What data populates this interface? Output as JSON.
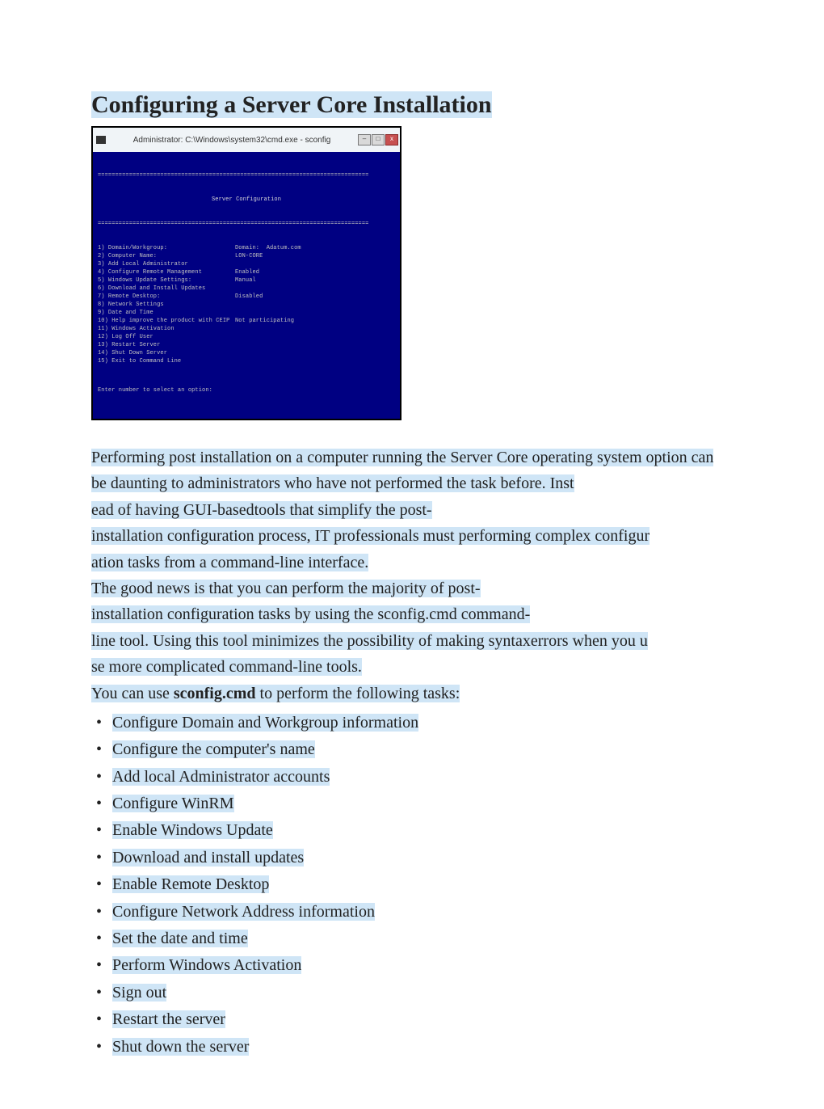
{
  "title": "Configuring a Server Core Installation",
  "screenshot": {
    "titlebar": "Administrator: C:\\Windows\\system32\\cmd.exe - sconfig",
    "divider": "==============================================================================",
    "header": "Server Configuration",
    "rows": [
      {
        "l": "1) Domain/Workgroup:",
        "r": "Domain:  Adatum.com"
      },
      {
        "l": "2) Computer Name:",
        "r": "LON-CORE"
      },
      {
        "l": "3) Add Local Administrator",
        "r": ""
      },
      {
        "l": "4) Configure Remote Management",
        "r": "Enabled"
      },
      {
        "l": "",
        "r": ""
      },
      {
        "l": "5) Windows Update Settings:",
        "r": "Manual"
      },
      {
        "l": "6) Download and Install Updates",
        "r": ""
      },
      {
        "l": "7) Remote Desktop:",
        "r": "Disabled"
      },
      {
        "l": "",
        "r": ""
      },
      {
        "l": "8) Network Settings",
        "r": ""
      },
      {
        "l": "9) Date and Time",
        "r": ""
      },
      {
        "l": "10) Help improve the product with CEIP",
        "r": "Not participating"
      },
      {
        "l": "11) Windows Activation",
        "r": ""
      },
      {
        "l": "",
        "r": ""
      },
      {
        "l": "12) Log Off User",
        "r": ""
      },
      {
        "l": "13) Restart Server",
        "r": ""
      },
      {
        "l": "14) Shut Down Server",
        "r": ""
      },
      {
        "l": "15) Exit to Command Line",
        "r": ""
      }
    ],
    "prompt": "Enter number to select an option:"
  },
  "para1_a": "Performing post installation on a computer running the Server Core operating system option can be daunting to administrators who have not performed the task before. Inst",
  "para1_b": "ead of having GUI-basedtools that simplify the post-",
  "para1_c": "installation configuration process, IT professionals must performing complex configur",
  "para1_d": "ation tasks from a command-line interface.",
  "para2_a": "The good news is that you can perform the majority of post-",
  "para2_b": "installation configuration tasks by using the sconfig.cmd command-",
  "para2_c": "line tool. Using this tool minimizes the possibility of making syntaxerrors when you u",
  "para2_d": "se more complicated command-line tools.",
  "tasks_intro_a": "You can use ",
  "tasks_intro_b": "sconfig.cmd",
  "tasks_intro_c": " to perform the following tasks:",
  "tasks": [
    "Configure Domain and Workgroup information",
    "Configure the computer's name",
    "Add local Administrator accounts",
    "Configure WinRM",
    "Enable Windows Update",
    "Download and install updates",
    "Enable Remote Desktop",
    "Configure Network Address information",
    "Set the date and time",
    "Perform Windows Activation",
    "Sign out",
    "Restart the server",
    "Shut down the server"
  ]
}
